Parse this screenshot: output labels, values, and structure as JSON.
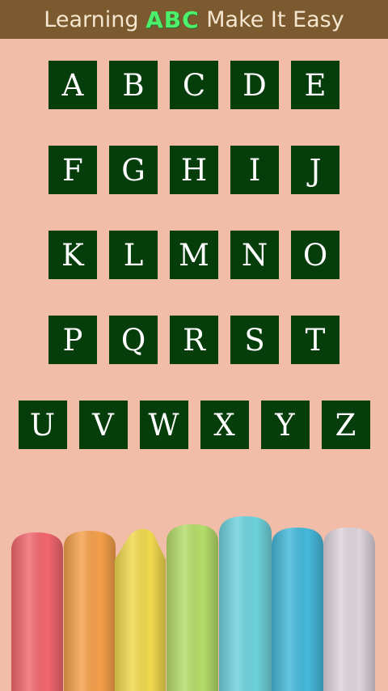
{
  "header": {
    "title_prefix": "Learning ",
    "title_highlight": "ABC",
    "title_suffix": " Make It Easy",
    "bg_color": "#7c5a2f",
    "highlight_color": "#4cf06a"
  },
  "letters": {
    "rows": [
      [
        "A",
        "B",
        "C",
        "D",
        "E"
      ],
      [
        "F",
        "G",
        "H",
        "I",
        "J"
      ],
      [
        "K",
        "L",
        "M",
        "N",
        "O"
      ],
      [
        "P",
        "Q",
        "R",
        "S",
        "T"
      ],
      [
        "U",
        "V",
        "W",
        "X",
        "Y",
        "Z"
      ]
    ],
    "tile_color": "#053d0b",
    "text_color": "#ffffff"
  },
  "background_color": "#f1bca8",
  "decoration": {
    "image": "colored-chalk-sticks",
    "chalk_colors": [
      "#f2676f",
      "#f4a04a",
      "#f0da4e",
      "#b5dd6a",
      "#6fd3dc",
      "#46b9da",
      "#ddd4dc"
    ]
  }
}
